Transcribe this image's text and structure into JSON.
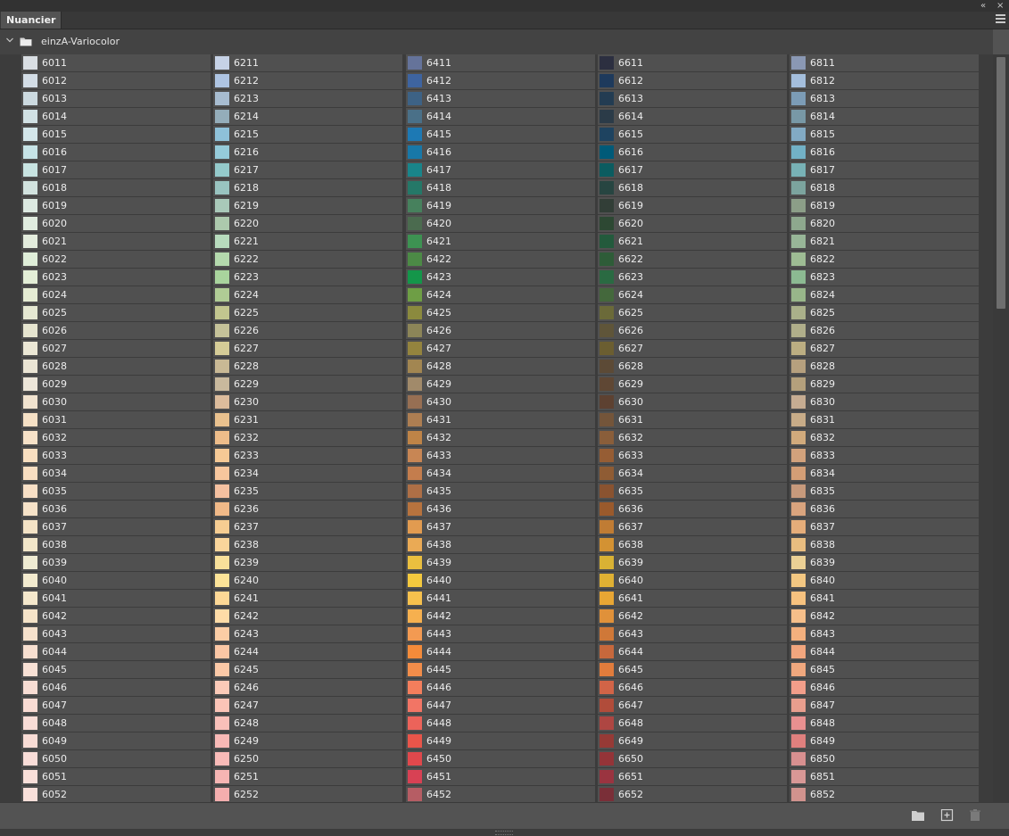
{
  "panel": {
    "tab_label": "Nuancier",
    "collapse_glyph": "«",
    "close_glyph": "×",
    "menu_icon": "hamburger-menu-icon"
  },
  "group": {
    "name": "einzA-Variocolor",
    "expanded": true
  },
  "swatch_columns": [
    [
      {
        "code": "6011",
        "color": "#d9dee3"
      },
      {
        "code": "6012",
        "color": "#d3dde6"
      },
      {
        "code": "6013",
        "color": "#ccdae0"
      },
      {
        "code": "6014",
        "color": "#d1e1e4"
      },
      {
        "code": "6015",
        "color": "#d3e6ea"
      },
      {
        "code": "6016",
        "color": "#c6e3e6"
      },
      {
        "code": "6017",
        "color": "#c8e4e2"
      },
      {
        "code": "6018",
        "color": "#d2e3df"
      },
      {
        "code": "6019",
        "color": "#dce9e1"
      },
      {
        "code": "6020",
        "color": "#e0ecdf"
      },
      {
        "code": "6021",
        "color": "#e3ecdd"
      },
      {
        "code": "6022",
        "color": "#dfeed9"
      },
      {
        "code": "6023",
        "color": "#e3eed6"
      },
      {
        "code": "6024",
        "color": "#e5ecd3"
      },
      {
        "code": "6025",
        "color": "#e5e8d2"
      },
      {
        "code": "6026",
        "color": "#e6e5d0"
      },
      {
        "code": "6027",
        "color": "#ebe7d5"
      },
      {
        "code": "6028",
        "color": "#ebe5d4"
      },
      {
        "code": "6029",
        "color": "#ede6d9"
      },
      {
        "code": "6030",
        "color": "#f1e3cf"
      },
      {
        "code": "6031",
        "color": "#f6e1c6"
      },
      {
        "code": "6032",
        "color": "#f7e2c8"
      },
      {
        "code": "6033",
        "color": "#f9dfc0"
      },
      {
        "code": "6034",
        "color": "#f8dec1"
      },
      {
        "code": "6035",
        "color": "#f8e0c6"
      },
      {
        "code": "6036",
        "color": "#f6e2c8"
      },
      {
        "code": "6037",
        "color": "#f4e3c6"
      },
      {
        "code": "6038",
        "color": "#f2e6c9"
      },
      {
        "code": "6039",
        "color": "#efebd2"
      },
      {
        "code": "6040",
        "color": "#f3ebcf"
      },
      {
        "code": "6041",
        "color": "#f5e8cc"
      },
      {
        "code": "6042",
        "color": "#f5e3c8"
      },
      {
        "code": "6043",
        "color": "#f6e1cc"
      },
      {
        "code": "6044",
        "color": "#f7dfd0"
      },
      {
        "code": "6045",
        "color": "#f8e1d5"
      },
      {
        "code": "6046",
        "color": "#f8ddd4"
      },
      {
        "code": "6047",
        "color": "#f9dbd3"
      },
      {
        "code": "6048",
        "color": "#f8dcd6"
      },
      {
        "code": "6049",
        "color": "#f8dcd5"
      },
      {
        "code": "6050",
        "color": "#f9ddd8"
      },
      {
        "code": "6051",
        "color": "#f9dfd9"
      },
      {
        "code": "6052",
        "color": "#f9e0da"
      }
    ],
    [
      {
        "code": "6211",
        "color": "#c6d2e6"
      },
      {
        "code": "6212",
        "color": "#aec4e2"
      },
      {
        "code": "6213",
        "color": "#a7bcd0"
      },
      {
        "code": "6214",
        "color": "#94adba"
      },
      {
        "code": "6215",
        "color": "#8ec1d9"
      },
      {
        "code": "6216",
        "color": "#95cbda"
      },
      {
        "code": "6217",
        "color": "#94cacb"
      },
      {
        "code": "6218",
        "color": "#99c4c0"
      },
      {
        "code": "6219",
        "color": "#a9c9b9"
      },
      {
        "code": "6220",
        "color": "#acc9ad"
      },
      {
        "code": "6221",
        "color": "#b7dbbd"
      },
      {
        "code": "6222",
        "color": "#b4d9ad"
      },
      {
        "code": "6223",
        "color": "#a9d49d"
      },
      {
        "code": "6224",
        "color": "#b0cc95"
      },
      {
        "code": "6225",
        "color": "#c2c68f"
      },
      {
        "code": "6226",
        "color": "#c5c299"
      },
      {
        "code": "6227",
        "color": "#d5cc97"
      },
      {
        "code": "6228",
        "color": "#c9b995"
      },
      {
        "code": "6229",
        "color": "#c9b99d"
      },
      {
        "code": "6230",
        "color": "#dcbc9c"
      },
      {
        "code": "6231",
        "color": "#e9c18e"
      },
      {
        "code": "6232",
        "color": "#eebd8a"
      },
      {
        "code": "6233",
        "color": "#f6c995"
      },
      {
        "code": "6234",
        "color": "#f7c69d"
      },
      {
        "code": "6235",
        "color": "#f4c0a0"
      },
      {
        "code": "6236",
        "color": "#f0b988"
      },
      {
        "code": "6237",
        "color": "#f6cd92"
      },
      {
        "code": "6238",
        "color": "#fad59b"
      },
      {
        "code": "6239",
        "color": "#f8e09a"
      },
      {
        "code": "6240",
        "color": "#fce398"
      },
      {
        "code": "6241",
        "color": "#fdd896"
      },
      {
        "code": "6242",
        "color": "#fedca7"
      },
      {
        "code": "6243",
        "color": "#fbcda5"
      },
      {
        "code": "6244",
        "color": "#fbc7a5"
      },
      {
        "code": "6245",
        "color": "#fbc9a7"
      },
      {
        "code": "6246",
        "color": "#fbcab8"
      },
      {
        "code": "6247",
        "color": "#fbc4b7"
      },
      {
        "code": "6248",
        "color": "#f9c0b9"
      },
      {
        "code": "6249",
        "color": "#f8b9b6"
      },
      {
        "code": "6250",
        "color": "#f9bbb8"
      },
      {
        "code": "6251",
        "color": "#f6b5b3"
      },
      {
        "code": "6252",
        "color": "#f4aeae"
      }
    ],
    [
      {
        "code": "6411",
        "color": "#65739a"
      },
      {
        "code": "6412",
        "color": "#3e64a0"
      },
      {
        "code": "6413",
        "color": "#3d6285"
      },
      {
        "code": "6414",
        "color": "#4a7088"
      },
      {
        "code": "6415",
        "color": "#1d79b4"
      },
      {
        "code": "6416",
        "color": "#1878a8"
      },
      {
        "code": "6417",
        "color": "#19858a"
      },
      {
        "code": "6418",
        "color": "#257868"
      },
      {
        "code": "6419",
        "color": "#47815d"
      },
      {
        "code": "6420",
        "color": "#4b6b4f"
      },
      {
        "code": "6421",
        "color": "#3d9252"
      },
      {
        "code": "6422",
        "color": "#4c8a46"
      },
      {
        "code": "6423",
        "color": "#14964a"
      },
      {
        "code": "6424",
        "color": "#6e9e45"
      },
      {
        "code": "6425",
        "color": "#8b8a3e"
      },
      {
        "code": "6426",
        "color": "#8c8558"
      },
      {
        "code": "6427",
        "color": "#94843e"
      },
      {
        "code": "6428",
        "color": "#a28651"
      },
      {
        "code": "6429",
        "color": "#a18a6a"
      },
      {
        "code": "6430",
        "color": "#976f53"
      },
      {
        "code": "6431",
        "color": "#ad7e52"
      },
      {
        "code": "6432",
        "color": "#bf8447"
      },
      {
        "code": "6433",
        "color": "#c88654"
      },
      {
        "code": "6434",
        "color": "#c47d4d"
      },
      {
        "code": "6435",
        "color": "#ae6f46"
      },
      {
        "code": "6436",
        "color": "#b7733e"
      },
      {
        "code": "6437",
        "color": "#e29b50"
      },
      {
        "code": "6438",
        "color": "#eaaa55"
      },
      {
        "code": "6439",
        "color": "#eabf3f"
      },
      {
        "code": "6440",
        "color": "#f4c93e"
      },
      {
        "code": "6441",
        "color": "#f7c14d"
      },
      {
        "code": "6442",
        "color": "#f6b04f"
      },
      {
        "code": "6443",
        "color": "#f39a52"
      },
      {
        "code": "6444",
        "color": "#f48b3a"
      },
      {
        "code": "6445",
        "color": "#f28d4a"
      },
      {
        "code": "6446",
        "color": "#f47e5c"
      },
      {
        "code": "6447",
        "color": "#f27565"
      },
      {
        "code": "6448",
        "color": "#ec635a"
      },
      {
        "code": "6449",
        "color": "#e8554a"
      },
      {
        "code": "6450",
        "color": "#e0484c"
      },
      {
        "code": "6451",
        "color": "#d84154"
      },
      {
        "code": "6452",
        "color": "#b65d64"
      }
    ],
    [
      {
        "code": "6611",
        "color": "#2c2f40"
      },
      {
        "code": "6612",
        "color": "#1e3a5c"
      },
      {
        "code": "6613",
        "color": "#233c52"
      },
      {
        "code": "6614",
        "color": "#2b3b48"
      },
      {
        "code": "6615",
        "color": "#1e4360"
      },
      {
        "code": "6616",
        "color": "#005a78"
      },
      {
        "code": "6617",
        "color": "#0b5c60"
      },
      {
        "code": "6618",
        "color": "#274541"
      },
      {
        "code": "6619",
        "color": "#323e37"
      },
      {
        "code": "6620",
        "color": "#2d4833"
      },
      {
        "code": "6621",
        "color": "#235a3c"
      },
      {
        "code": "6622",
        "color": "#2e5c38"
      },
      {
        "code": "6623",
        "color": "#2a6a42"
      },
      {
        "code": "6624",
        "color": "#44683c"
      },
      {
        "code": "6625",
        "color": "#6b6a39"
      },
      {
        "code": "6626",
        "color": "#5f5539"
      },
      {
        "code": "6627",
        "color": "#6b5e31"
      },
      {
        "code": "6628",
        "color": "#5c4a36"
      },
      {
        "code": "6629",
        "color": "#5f4734"
      },
      {
        "code": "6630",
        "color": "#5d4131"
      },
      {
        "code": "6631",
        "color": "#74553a"
      },
      {
        "code": "6632",
        "color": "#8a5e3a"
      },
      {
        "code": "6633",
        "color": "#965d34"
      },
      {
        "code": "6634",
        "color": "#8f5c34"
      },
      {
        "code": "6635",
        "color": "#8a5330"
      },
      {
        "code": "6636",
        "color": "#9a5a2c"
      },
      {
        "code": "6637",
        "color": "#c07c34"
      },
      {
        "code": "6638",
        "color": "#d39233"
      },
      {
        "code": "6639",
        "color": "#d9b234"
      },
      {
        "code": "6640",
        "color": "#e0b133"
      },
      {
        "code": "6641",
        "color": "#e8a634"
      },
      {
        "code": "6642",
        "color": "#e0913a"
      },
      {
        "code": "6643",
        "color": "#cf7838"
      },
      {
        "code": "6644",
        "color": "#c7683c"
      },
      {
        "code": "6645",
        "color": "#e17c3c"
      },
      {
        "code": "6646",
        "color": "#d26447"
      },
      {
        "code": "6647",
        "color": "#b14c3a"
      },
      {
        "code": "6648",
        "color": "#ae4642"
      },
      {
        "code": "6649",
        "color": "#963a36"
      },
      {
        "code": "6650",
        "color": "#943438"
      },
      {
        "code": "6651",
        "color": "#9a3440"
      },
      {
        "code": "6652",
        "color": "#7a2f38"
      }
    ],
    [
      {
        "code": "6811",
        "color": "#8a98b4"
      },
      {
        "code": "6812",
        "color": "#a4bedc"
      },
      {
        "code": "6813",
        "color": "#7c9cb6"
      },
      {
        "code": "6814",
        "color": "#7898a6"
      },
      {
        "code": "6815",
        "color": "#82aac4"
      },
      {
        "code": "6816",
        "color": "#72b1c6"
      },
      {
        "code": "6817",
        "color": "#78b2b6"
      },
      {
        "code": "6818",
        "color": "#7ca49e"
      },
      {
        "code": "6819",
        "color": "#8c9e88"
      },
      {
        "code": "6820",
        "color": "#8ea88e"
      },
      {
        "code": "6821",
        "color": "#98b698"
      },
      {
        "code": "6822",
        "color": "#9ebc94"
      },
      {
        "code": "6823",
        "color": "#8cba92"
      },
      {
        "code": "6824",
        "color": "#98b68a"
      },
      {
        "code": "6825",
        "color": "#aab08a"
      },
      {
        "code": "6826",
        "color": "#b0ae8a"
      },
      {
        "code": "6827",
        "color": "#bcae82"
      },
      {
        "code": "6828",
        "color": "#b6a07e"
      },
      {
        "code": "6829",
        "color": "#b4a07c"
      },
      {
        "code": "6830",
        "color": "#c6ac92"
      },
      {
        "code": "6831",
        "color": "#c8ac88"
      },
      {
        "code": "6832",
        "color": "#d1aa7c"
      },
      {
        "code": "6833",
        "color": "#d2a27c"
      },
      {
        "code": "6834",
        "color": "#d39e76"
      },
      {
        "code": "6835",
        "color": "#c79a7c"
      },
      {
        "code": "6836",
        "color": "#d9a47e"
      },
      {
        "code": "6837",
        "color": "#e5ad7a"
      },
      {
        "code": "6838",
        "color": "#e8bd80"
      },
      {
        "code": "6839",
        "color": "#ebd095"
      },
      {
        "code": "6840",
        "color": "#f3c782"
      },
      {
        "code": "6841",
        "color": "#f7c27f"
      },
      {
        "code": "6842",
        "color": "#f6bf8a"
      },
      {
        "code": "6843",
        "color": "#f3b07e"
      },
      {
        "code": "6844",
        "color": "#f2a67e"
      },
      {
        "code": "6845",
        "color": "#f0a87e"
      },
      {
        "code": "6846",
        "color": "#f29e8a"
      },
      {
        "code": "6847",
        "color": "#e89e8e"
      },
      {
        "code": "6848",
        "color": "#e89090"
      },
      {
        "code": "6849",
        "color": "#e0807e"
      },
      {
        "code": "6850",
        "color": "#d89090"
      },
      {
        "code": "6851",
        "color": "#d99896"
      },
      {
        "code": "6852",
        "color": "#d1938e"
      }
    ]
  ],
  "bottom_toolbar": {
    "icons": [
      "new-group-folder-icon",
      "new-swatch-icon",
      "delete-trash-icon"
    ]
  }
}
